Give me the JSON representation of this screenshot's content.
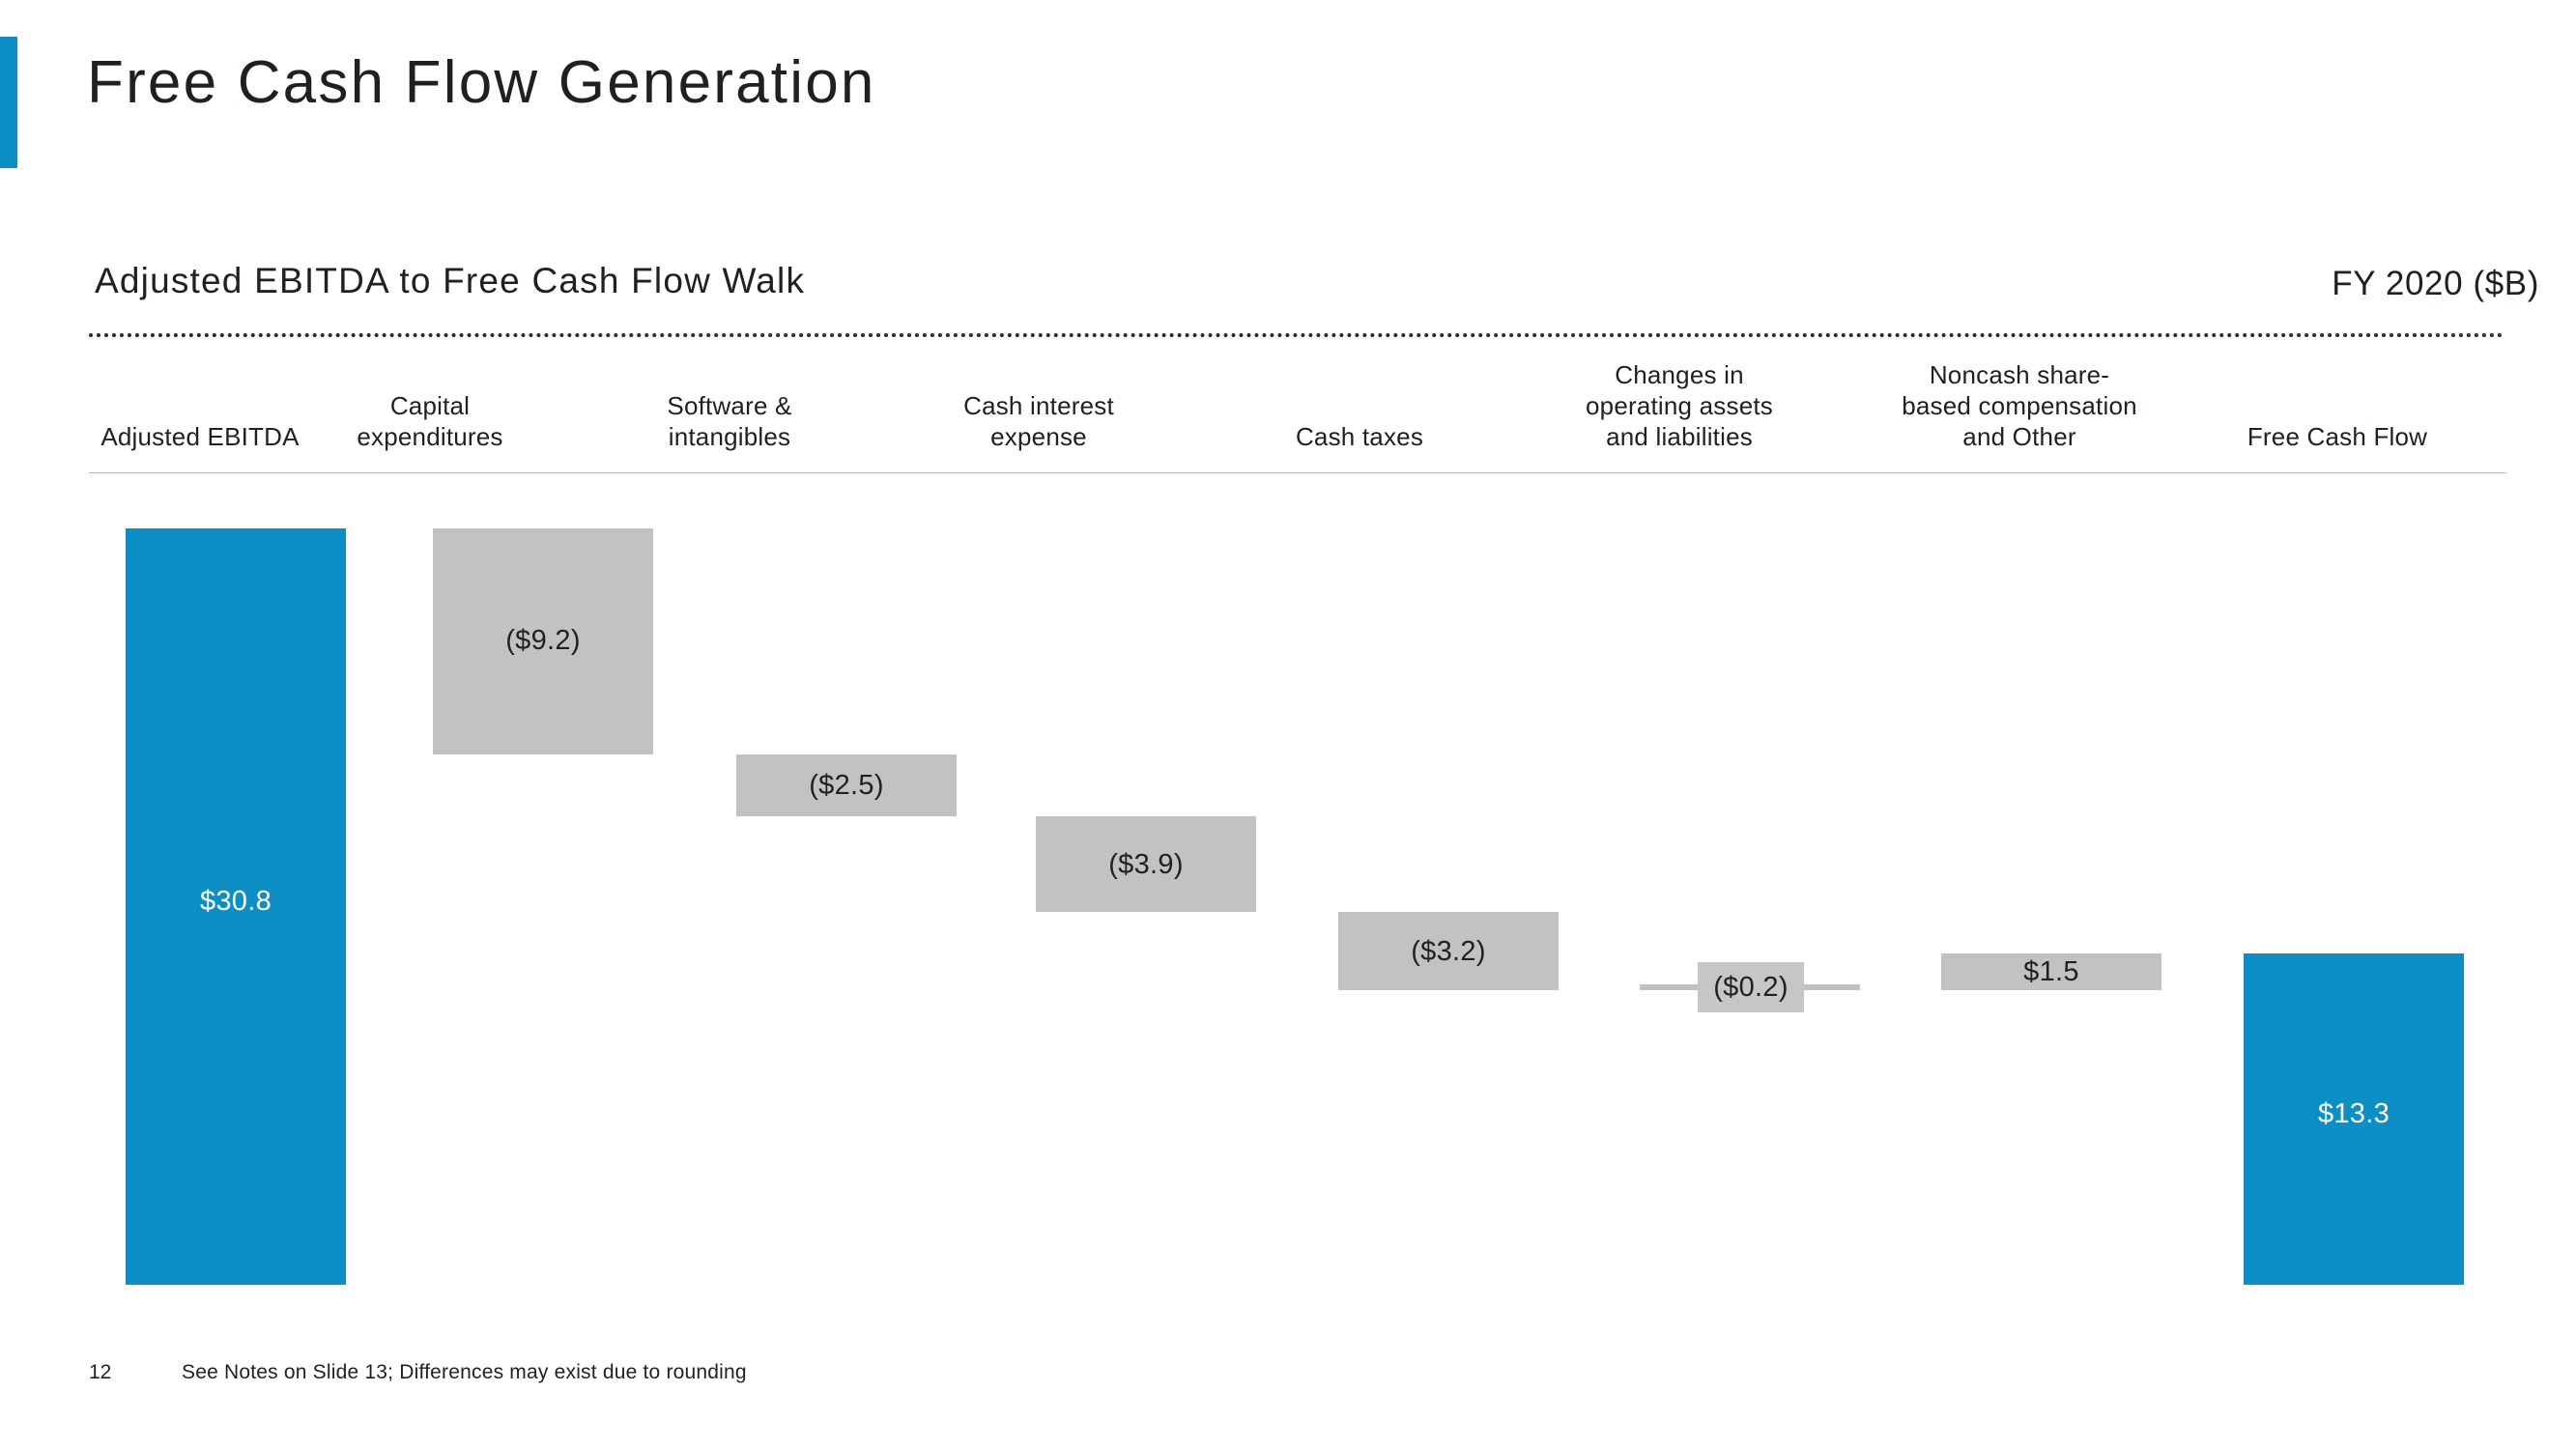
{
  "slide": {
    "title": "Free Cash Flow Generation",
    "accent_color": "#0d8ec4",
    "page_number": "12",
    "footnote": "See Notes on Slide 13; Differences may exist due to rounding"
  },
  "chart_header": {
    "subtitle": "Adjusted EBITDA to Free Cash Flow Walk",
    "period": "FY 2020 ($B)"
  },
  "chart_data": {
    "type": "bar",
    "subtype": "waterfall",
    "title": "Adjusted EBITDA to Free Cash Flow Walk",
    "subtitle": "FY 2020 ($B)",
    "xlabel": "",
    "ylabel": "",
    "units": "$B",
    "grid": false,
    "legend": null,
    "ylim": [
      0,
      32.5
    ],
    "categories": [
      "Adjusted EBITDA",
      "Capital expenditures",
      "Software & intangibles",
      "Cash interest expense",
      "Cash taxes",
      "Changes in operating assets and liabilities",
      "Noncash share-based compensation and Other",
      "Free Cash Flow"
    ],
    "category_lines": [
      [
        "Adjusted EBITDA"
      ],
      [
        "Capital",
        "expenditures"
      ],
      [
        "Software &",
        "intangibles"
      ],
      [
        "Cash interest",
        "expense"
      ],
      [
        "Cash taxes"
      ],
      [
        "Changes in",
        "operating assets",
        "and liabilities"
      ],
      [
        "Noncash share-",
        "based compensation",
        "and Other"
      ],
      [
        "Free Cash Flow"
      ]
    ],
    "values": [
      30.8,
      -9.2,
      -2.5,
      -3.9,
      -3.2,
      -0.2,
      1.5,
      13.3
    ],
    "labels": [
      "$30.8",
      "($9.2)",
      "($2.5)",
      "($3.9)",
      "($3.2)",
      "($0.2)",
      "$1.5",
      "$13.3"
    ],
    "bar_kinds": [
      "total",
      "delta",
      "delta",
      "delta",
      "delta",
      "delta",
      "delta",
      "total"
    ],
    "cumulative_start": [
      0,
      21.6,
      19.1,
      15.2,
      12.0,
      11.8,
      11.8,
      0
    ],
    "cumulative_end": [
      30.8,
      30.8,
      21.6,
      19.1,
      15.2,
      12.0,
      13.3,
      13.3
    ],
    "colors": {
      "total": "#0d8ec4",
      "delta": "#c2c2c2",
      "total_label": "#ffffff",
      "delta_label": "#231f20"
    }
  },
  "bars": [
    {
      "label": "$30.8",
      "name": "bar-adjusted-ebitda"
    },
    {
      "label": "($9.2)",
      "name": "bar-capital-expenditures"
    },
    {
      "label": "($2.5)",
      "name": "bar-software-intangibles"
    },
    {
      "label": "($3.9)",
      "name": "bar-cash-interest-expense"
    },
    {
      "label": "($3.2)",
      "name": "bar-cash-taxes"
    },
    {
      "label": "($0.2)",
      "name": "bar-changes-operating-assets"
    },
    {
      "label": "$1.5",
      "name": "bar-noncash-share-based-comp"
    },
    {
      "label": "$13.3",
      "name": "bar-free-cash-flow"
    }
  ]
}
